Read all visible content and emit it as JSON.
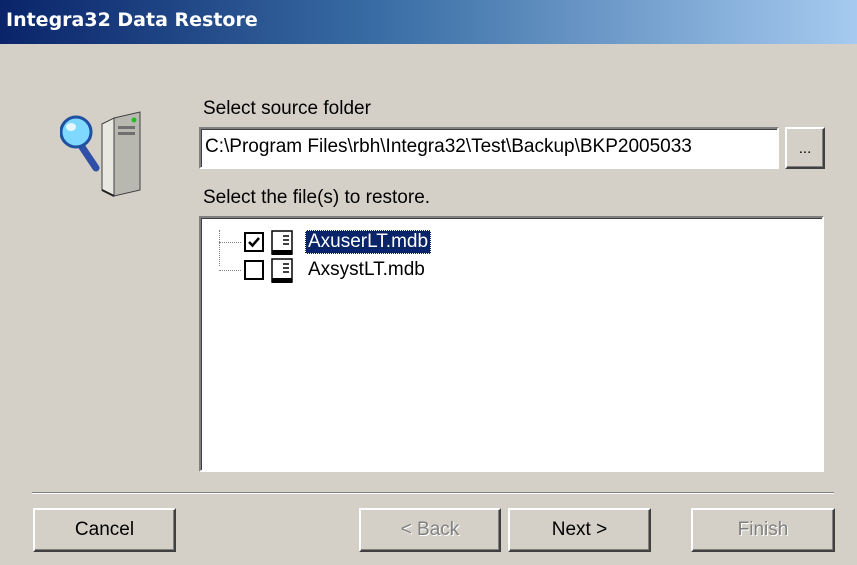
{
  "window": {
    "title": "Integra32 Data Restore"
  },
  "source": {
    "label": "Select source folder",
    "path": "C:\\Program Files\\rbh\\Integra32\\Test\\Backup\\BKP2005033",
    "browse_label": "..."
  },
  "files": {
    "label": "Select the file(s) to restore.",
    "items": [
      {
        "name": "AxuserLT.mdb",
        "checked": true,
        "selected": true
      },
      {
        "name": "AxsystLT.mdb",
        "checked": false,
        "selected": false
      }
    ]
  },
  "buttons": {
    "cancel": "Cancel",
    "back": "< Back",
    "next": "Next >",
    "finish": "Finish"
  },
  "icons": {
    "wizard": "server-search-icon",
    "file": "database-file-icon"
  },
  "colors": {
    "face": "#d4d0c8",
    "title_start": "#0a246a",
    "title_end": "#a6caf0",
    "selection": "#0a246a"
  }
}
